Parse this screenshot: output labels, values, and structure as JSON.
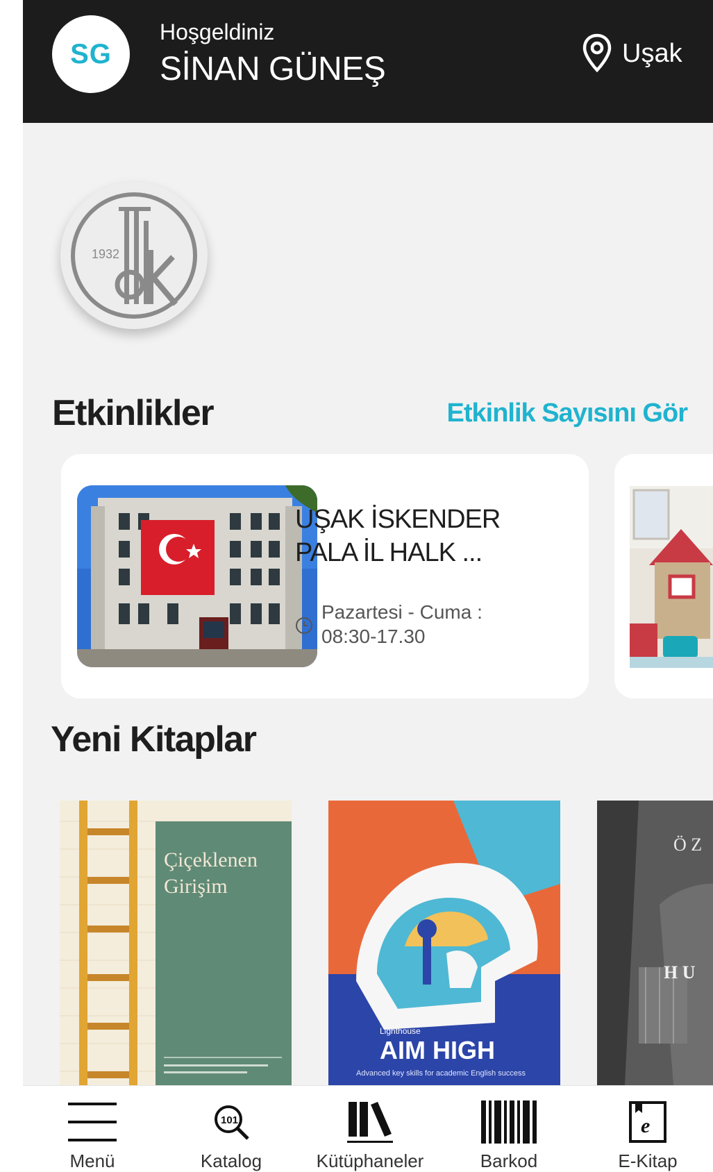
{
  "header": {
    "avatar_initials": "SG",
    "greeting": "Hoşgeldiniz",
    "user_name": "SİNAN GÜNEŞ",
    "location": "Uşak",
    "background": "#1c1c1c",
    "accent": "#1fb3cf"
  },
  "logo": {
    "year": "1932",
    "icon": "tdk-logo-icon"
  },
  "events": {
    "title": "Etkinlikler",
    "see_all": "Etkinlik Sayısını Gör",
    "cards": [
      {
        "title": "UŞAK  İSKENDER PALA İL HALK ...",
        "hours_line1": "Pazartesi - Cuma :",
        "hours_line2": "08:30-17.30"
      }
    ]
  },
  "new_books": {
    "title": "Yeni Kitaplar",
    "items": [
      {
        "title_line1": "Çiçeklenen",
        "title_line2": "Girişim"
      },
      {
        "series": "Lighthouse",
        "title": "AIM HIGH",
        "subtitle": "Advanced key skills for academic English success"
      },
      {
        "title_top": "Ö Z",
        "title_mid": "H U"
      }
    ]
  },
  "bottom_nav": [
    {
      "label": "Menü",
      "icon": "menu-icon"
    },
    {
      "label": "Katalog",
      "icon": "catalog-search-icon"
    },
    {
      "label": "Kütüphaneler",
      "icon": "libraries-icon"
    },
    {
      "label": "Barkod",
      "icon": "barcode-icon"
    },
    {
      "label": "E-Kitap",
      "icon": "ebook-icon"
    }
  ]
}
